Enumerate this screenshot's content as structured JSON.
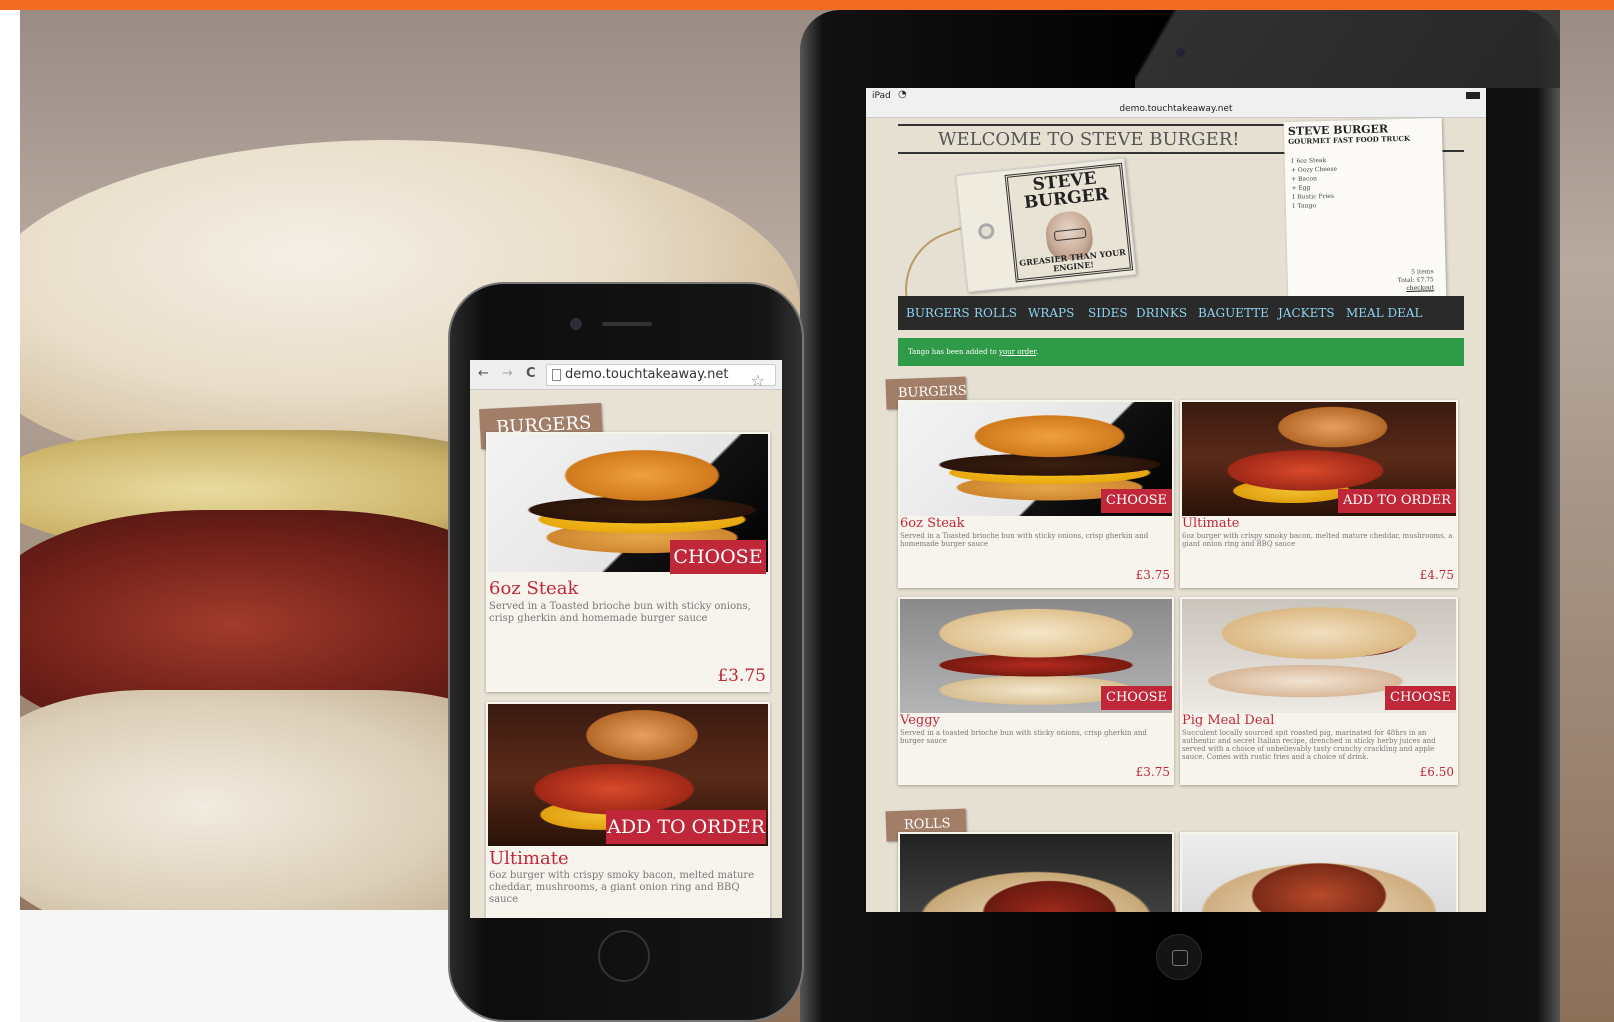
{
  "phone": {
    "url": "demo.touchtakeaway.net",
    "nav_back": "←",
    "nav_forward": "→",
    "nav_reload": "C",
    "star": "☆",
    "section": "BURGERS",
    "items": [
      {
        "name": "6oz Steak",
        "desc": "Served in a Toasted brioche bun with sticky onions, crisp gherkin and homemade burger sauce",
        "price": "£3.75",
        "button": "CHOOSE"
      },
      {
        "name": "Ultimate",
        "desc": "6oz burger with crispy smoky bacon, melted mature cheddar, mushrooms, a giant onion ring and BBQ sauce",
        "button": "ADD TO ORDER"
      }
    ]
  },
  "ipad": {
    "status_device": "iPad",
    "url": "demo.touchtakeaway.net",
    "welcome": "WELCOME TO STEVE BURGER!",
    "logo_title": "STEVE BURGER",
    "logo_tagline": "GREASIER THAN YOUR ENGINE!",
    "order": {
      "title": "STEVE BURGER",
      "subtitle": "GOURMET FAST FOOD TRUCK",
      "lines": [
        "1 6oz Steak",
        "+ Oozy Cheese",
        "+ Bacon",
        "+ Egg",
        "1 Rustic Fries",
        "1 Tango"
      ],
      "count": "5 items",
      "total": "Total: £7.75",
      "checkout": "checkout"
    },
    "nav": [
      "BURGERS",
      "ROLLS",
      "WRAPS",
      "SIDES",
      "DRINKS",
      "BAGUETTE",
      "JACKETS",
      "MEAL DEAL"
    ],
    "alert_text": "Tango has been added to",
    "alert_link": "your order",
    "alert_end": ".",
    "section_burgers": "BURGERS",
    "section_rolls": "ROLLS",
    "items": [
      {
        "name": "6oz Steak",
        "desc": "Served in a Toasted brioche bun with sticky onions, crisp gherkin and homemade burger sauce",
        "price": "£3.75",
        "button": "CHOOSE"
      },
      {
        "name": "Ultimate",
        "desc": "6oz burger with crispy smoky bacon, melted mature cheddar, mushrooms, a giant onion ring and BBQ sauce",
        "price": "£4.75",
        "button": "ADD TO ORDER"
      },
      {
        "name": "Veggy",
        "desc": "Served in a toasted brioche bun with sticky onions, crisp gherkin and burger sauce",
        "price": "£3.75",
        "button": "CHOOSE"
      },
      {
        "name": "Pig Meal Deal",
        "desc": "Succulent locally sourced spit roasted pig, marinated for 48hrs in an authentic and secret Italian recipe, drenched in sticky herby juices and served with a choice of unbelievably tasty crunchy crackling and apple sauce. Comes with rustic fries and a choice of drink.",
        "price": "£6.50",
        "button": "CHOOSE"
      }
    ]
  },
  "colors": {
    "accent": "#f26b22",
    "brand_red": "#c0283a",
    "nav_link": "#8fd3f0",
    "success": "#2f9a48"
  }
}
